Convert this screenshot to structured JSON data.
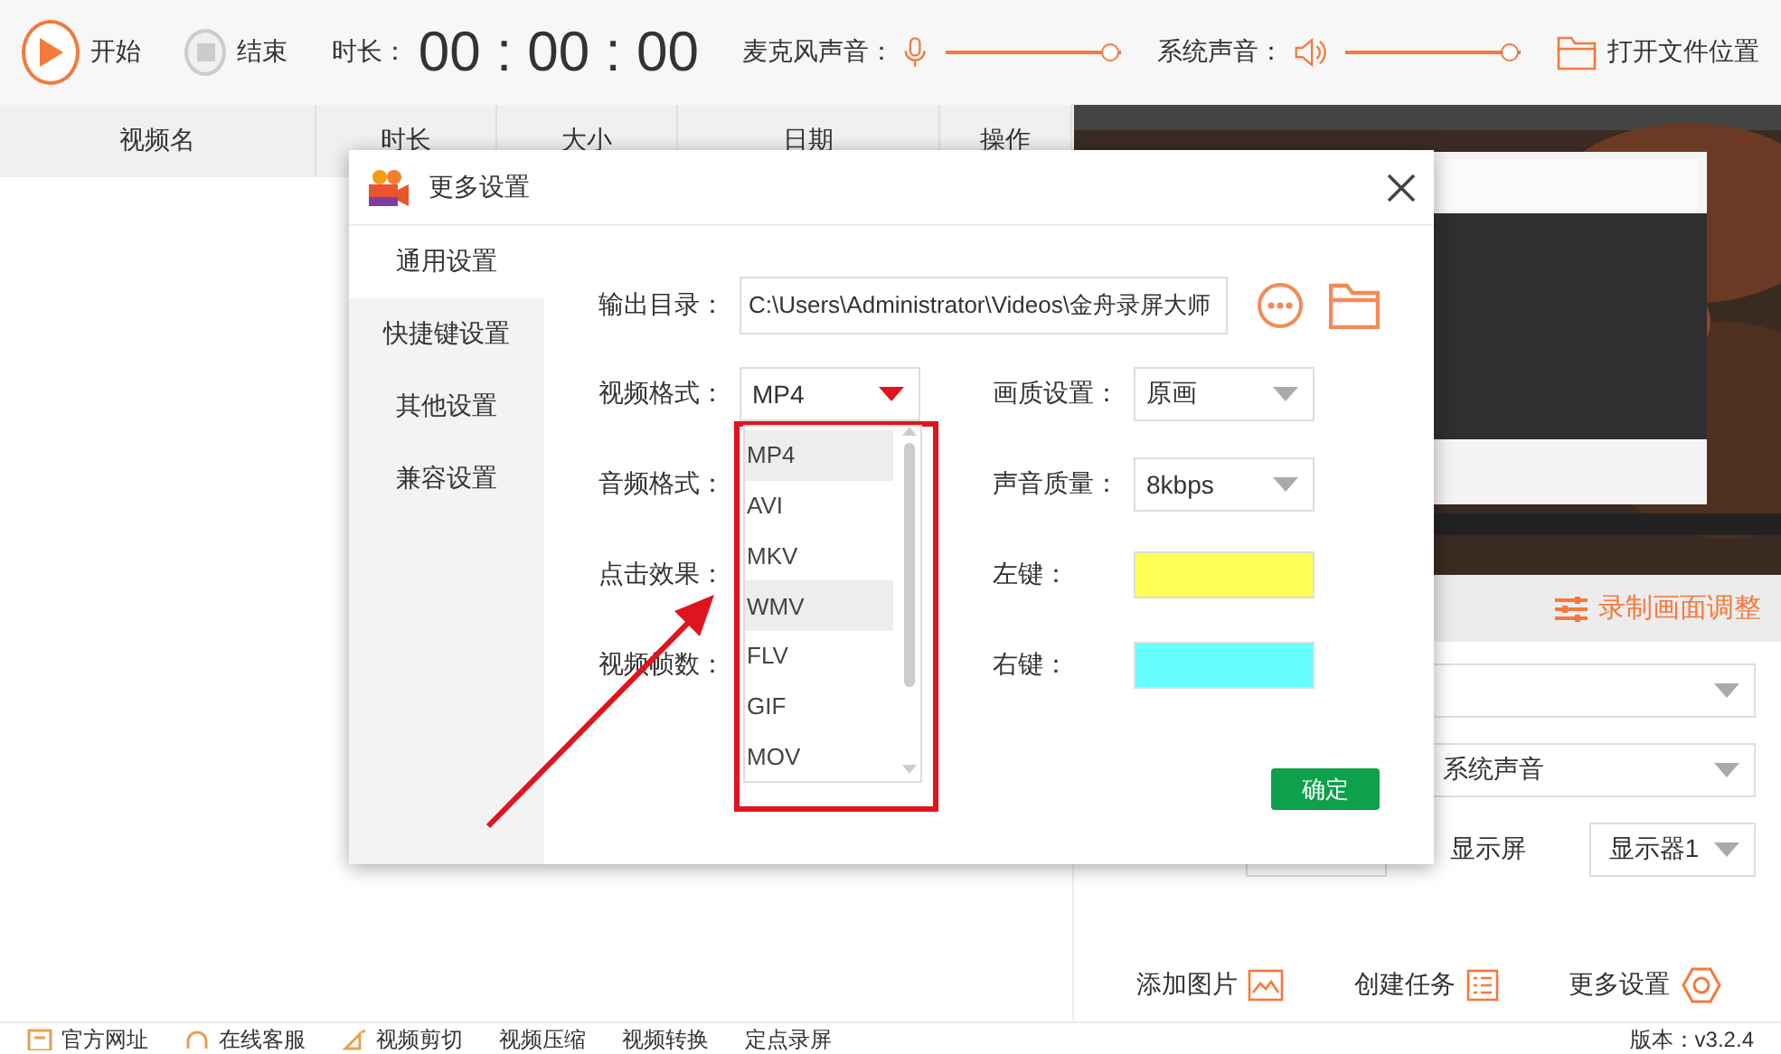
{
  "toolbar": {
    "start": "开始",
    "stop": "结束",
    "duration_label": "时长：",
    "timer": "00 : 00 : 00",
    "mic_label": "麦克风声音：",
    "mic": {
      "level": 1
    },
    "system_label": "系统声音：",
    "system": {
      "level": 1
    },
    "open_folder": "打开文件位置"
  },
  "table": {
    "columns": [
      "视频名",
      "时长",
      "大小",
      "日期",
      "操作"
    ]
  },
  "record_panel": {
    "title": "录制画面调整",
    "audio_select": "系统声音",
    "screen_label": "显示屏",
    "screen_select": "显示器1",
    "actions": [
      "添加图片",
      "创建任务",
      "更多设置"
    ]
  },
  "dialog": {
    "title": "更多设置",
    "nav": [
      {
        "label": "通用设置",
        "selected": true
      },
      {
        "label": "快捷键设置",
        "selected": false
      },
      {
        "label": "其他设置",
        "selected": false
      },
      {
        "label": "兼容设置",
        "selected": false
      }
    ],
    "output_label": "输出目录：",
    "output_path": "C:\\Users\\Administrator\\Videos\\金舟录屏大师",
    "left_fields": [
      {
        "label": "视频格式：",
        "kind": "select",
        "value": "MP4",
        "expanded": true
      },
      {
        "label": "音频格式：",
        "kind": "hidden"
      },
      {
        "label": "点击效果：",
        "kind": "hidden"
      },
      {
        "label": "视频帧数：",
        "kind": "hidden"
      }
    ],
    "right_fields": [
      {
        "label": "画质设置：",
        "kind": "select",
        "value": "原画",
        "expanded": false
      },
      {
        "label": "声音质量：",
        "kind": "select",
        "value": "8kbps",
        "expanded": false
      },
      {
        "label": "左键：",
        "kind": "color",
        "color": "#ffff55"
      },
      {
        "label": "右键：",
        "kind": "color",
        "color": "#66ffff"
      }
    ],
    "options": [
      {
        "label": "MP4",
        "highlighted": true
      },
      {
        "label": "AVI",
        "highlighted": false
      },
      {
        "label": "MKV",
        "highlighted": false
      },
      {
        "label": "WMV",
        "highlighted": true
      },
      {
        "label": "FLV",
        "highlighted": false
      },
      {
        "label": "GIF",
        "highlighted": false
      },
      {
        "label": "MOV",
        "highlighted": false
      }
    ],
    "confirm": "确定"
  },
  "bottom_bar": {
    "items": [
      "官方网址",
      "在线客服",
      "视频剪切",
      "视频压缩",
      "视频转换",
      "定点录屏"
    ],
    "version": "版本：v3.2.4"
  }
}
